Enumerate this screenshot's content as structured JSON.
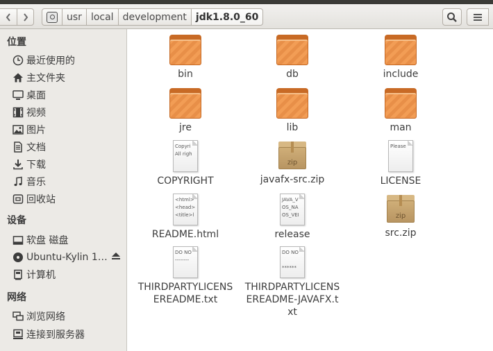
{
  "window": {
    "breadcrumbs": [
      "usr",
      "local",
      "development",
      "jdk1.8.0_60"
    ],
    "active_crumb": "jdk1.8.0_60"
  },
  "toolbar": {
    "back_icon": "chevron-left-icon",
    "forward_icon": "chevron-right-icon",
    "search_icon": "search-icon",
    "menu_icon": "menu-icon"
  },
  "sidebar": {
    "places_header": "位置",
    "places": [
      {
        "label": "最近使用的",
        "icon": "clock-icon"
      },
      {
        "label": "主文件夹",
        "icon": "home-icon"
      },
      {
        "label": "桌面",
        "icon": "desktop-icon"
      },
      {
        "label": "视频",
        "icon": "film-icon"
      },
      {
        "label": "图片",
        "icon": "image-icon"
      },
      {
        "label": "文档",
        "icon": "document-icon"
      },
      {
        "label": "下载",
        "icon": "download-icon"
      },
      {
        "label": "音乐",
        "icon": "music-icon"
      },
      {
        "label": "回收站",
        "icon": "trash-icon"
      }
    ],
    "devices_header": "设备",
    "devices": [
      {
        "label": "软盘 磁盘",
        "icon": "drive-icon"
      },
      {
        "label": "Ubuntu-Kylin 1…",
        "icon": "disc-icon"
      },
      {
        "label": "计算机",
        "icon": "computer-icon"
      }
    ],
    "network_header": "网络",
    "network": [
      {
        "label": "浏览网络",
        "icon": "network-icon"
      },
      {
        "label": "连接到服务器",
        "icon": "server-icon"
      }
    ]
  },
  "files": [
    {
      "name": "bin",
      "type": "folder"
    },
    {
      "name": "db",
      "type": "folder"
    },
    {
      "name": "include",
      "type": "folder"
    },
    {
      "name": "jre",
      "type": "folder"
    },
    {
      "name": "lib",
      "type": "folder"
    },
    {
      "name": "man",
      "type": "folder"
    },
    {
      "name": "COPYRIGHT",
      "type": "text",
      "preview": "Copyri\nAll righ"
    },
    {
      "name": "javafx-src.zip",
      "type": "zip",
      "badge": "zip"
    },
    {
      "name": "LICENSE",
      "type": "text",
      "preview": "Please"
    },
    {
      "name": "README.html",
      "type": "text",
      "preview": "<html>\n<head>\n<title>l"
    },
    {
      "name": "release",
      "type": "text",
      "preview": "JAVA_V\nOS_NA\nOS_VEI"
    },
    {
      "name": "src.zip",
      "type": "zip",
      "badge": "zip"
    },
    {
      "name": "THIRDPARTYLICENSEREADME.txt",
      "type": "text",
      "preview": "DO NO\n--------"
    },
    {
      "name": "THIRDPARTYLICENSEREADME-JAVAFX.txt",
      "type": "text",
      "preview": "DO NO\n\n******"
    }
  ]
}
